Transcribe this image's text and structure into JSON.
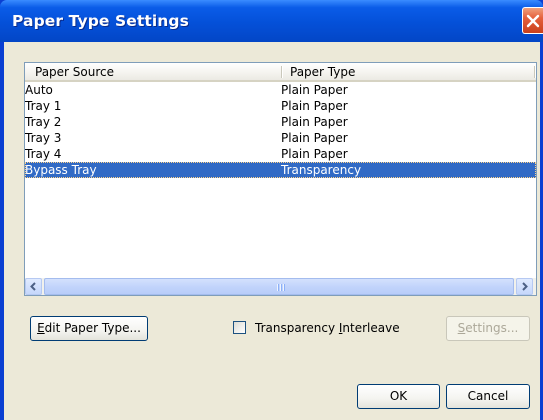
{
  "window": {
    "title": "Paper Type Settings"
  },
  "list": {
    "columns": [
      "Paper Source",
      "Paper Type"
    ],
    "rows": [
      {
        "source": "Auto",
        "type": "Plain Paper"
      },
      {
        "source": "Tray 1",
        "type": "Plain Paper"
      },
      {
        "source": "Tray 2",
        "type": "Plain Paper"
      },
      {
        "source": "Tray 3",
        "type": "Plain Paper"
      },
      {
        "source": "Tray 4",
        "type": "Plain Paper"
      },
      {
        "source": "Bypass Tray",
        "type": "Transparency",
        "selected": true
      }
    ]
  },
  "buttons": {
    "edit_paper_type_prefix": "E",
    "edit_paper_type_rest": "dit Paper Type...",
    "settings_prefix": "S",
    "settings_rest": "ettings...",
    "ok": "OK",
    "cancel": "Cancel"
  },
  "checkbox": {
    "label_before": "Transparency ",
    "label_accel": "I",
    "label_after": "nterleave",
    "checked": false
  },
  "icons": {
    "close": "close-icon",
    "scroll_left": "arrow-left-icon",
    "scroll_right": "arrow-right-icon",
    "grip": "scrollbar-grip-icon"
  },
  "colors": {
    "title_bar": "#0450d8",
    "selection": "#316ac5",
    "dialog_bg": "#ece9d8",
    "close_button": "#e5603c"
  }
}
